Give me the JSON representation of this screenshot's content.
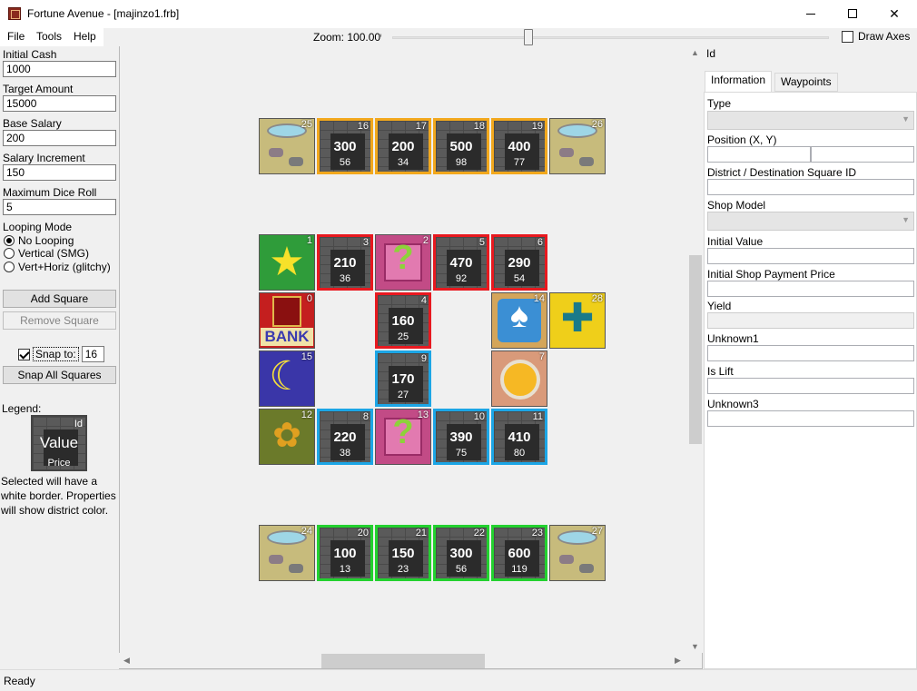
{
  "window": {
    "title": "Fortune Avenue - [majinzo1.frb]",
    "minimize": "—",
    "close": "✕"
  },
  "menu": {
    "file": "File",
    "tools": "Tools",
    "help": "Help"
  },
  "toolbar": {
    "zoom_label": "Zoom: 100.00%",
    "draw_axes": "Draw Axes",
    "draw_axes_checked": false
  },
  "left": {
    "initial_cash_label": "Initial Cash",
    "initial_cash": "1000",
    "target_amount_label": "Target Amount",
    "target_amount": "15000",
    "base_salary_label": "Base Salary",
    "base_salary": "200",
    "salary_increment_label": "Salary Increment",
    "salary_increment": "150",
    "max_dice_label": "Maximum Dice Roll",
    "max_dice": "5",
    "looping_label": "Looping Mode",
    "looping_options": [
      "No Looping",
      "Vertical (SMG)",
      "Vert+Horiz (glitchy)"
    ],
    "looping_selected": "No Looping",
    "add_square": "Add Square",
    "remove_square": "Remove Square",
    "snap_label": "Snap to:",
    "snap_value": "16",
    "snap_all": "Snap All Squares",
    "legend_label": "Legend:",
    "legend_id": "Id",
    "legend_value": "Value",
    "legend_price": "Price",
    "legend_text": "Selected will have a white border. Properties will show district color."
  },
  "board": {
    "colors": {
      "orange": "#f2a81d",
      "red": "#e8191f",
      "blue": "#1ca6e6",
      "green": "#23d12f"
    },
    "squares": [
      {
        "id": "25",
        "kind": "warp-icon"
      },
      {
        "id": "16",
        "value": "300",
        "price": "56",
        "district": "orange"
      },
      {
        "id": "17",
        "value": "200",
        "price": "34",
        "district": "orange"
      },
      {
        "id": "18",
        "value": "500",
        "price": "98",
        "district": "orange"
      },
      {
        "id": "19",
        "value": "400",
        "price": "77",
        "district": "orange"
      },
      {
        "id": "26",
        "kind": "warp-icon"
      },
      {
        "id": "1",
        "kind": "star-icon"
      },
      {
        "id": "3",
        "value": "210",
        "price": "36",
        "district": "red"
      },
      {
        "id": "2",
        "kind": "chance-icon"
      },
      {
        "id": "5",
        "value": "470",
        "price": "92",
        "district": "red"
      },
      {
        "id": "6",
        "value": "290",
        "price": "54",
        "district": "red"
      },
      {
        "id": "0",
        "kind": "bank-icon",
        "word": "BANK"
      },
      {
        "id": "4",
        "value": "160",
        "price": "25",
        "district": "red"
      },
      {
        "id": "14",
        "kind": "spade-icon"
      },
      {
        "id": "28",
        "kind": "cross-icon"
      },
      {
        "id": "15",
        "kind": "moon-icon"
      },
      {
        "id": "9",
        "value": "170",
        "price": "27",
        "district": "blue"
      },
      {
        "id": "7",
        "kind": "coin-icon"
      },
      {
        "id": "12",
        "kind": "bags-icon"
      },
      {
        "id": "8",
        "value": "220",
        "price": "38",
        "district": "blue"
      },
      {
        "id": "13",
        "kind": "chance-icon"
      },
      {
        "id": "10",
        "value": "390",
        "price": "75",
        "district": "blue"
      },
      {
        "id": "11",
        "value": "410",
        "price": "80",
        "district": "blue"
      },
      {
        "id": "24",
        "kind": "warp-icon"
      },
      {
        "id": "20",
        "value": "100",
        "price": "13",
        "district": "green"
      },
      {
        "id": "21",
        "value": "150",
        "price": "23",
        "district": "green"
      },
      {
        "id": "22",
        "value": "300",
        "price": "56",
        "district": "green"
      },
      {
        "id": "23",
        "value": "600",
        "price": "119",
        "district": "green"
      },
      {
        "id": "27",
        "kind": "warp-icon"
      }
    ]
  },
  "right": {
    "id_label": "Id",
    "tabs": [
      "Information",
      "Waypoints"
    ],
    "active_tab": "Information",
    "type_label": "Type",
    "position_label": "Position (X, Y)",
    "district_label": "District / Destination Square ID",
    "shop_model_label": "Shop Model",
    "initial_value_label": "Initial Value",
    "initial_payment_label": "Initial Shop Payment Price",
    "yield_label": "Yield",
    "unknown1_label": "Unknown1",
    "is_lift_label": "Is Lift",
    "unknown3_label": "Unknown3"
  },
  "status": {
    "text": "Ready"
  }
}
